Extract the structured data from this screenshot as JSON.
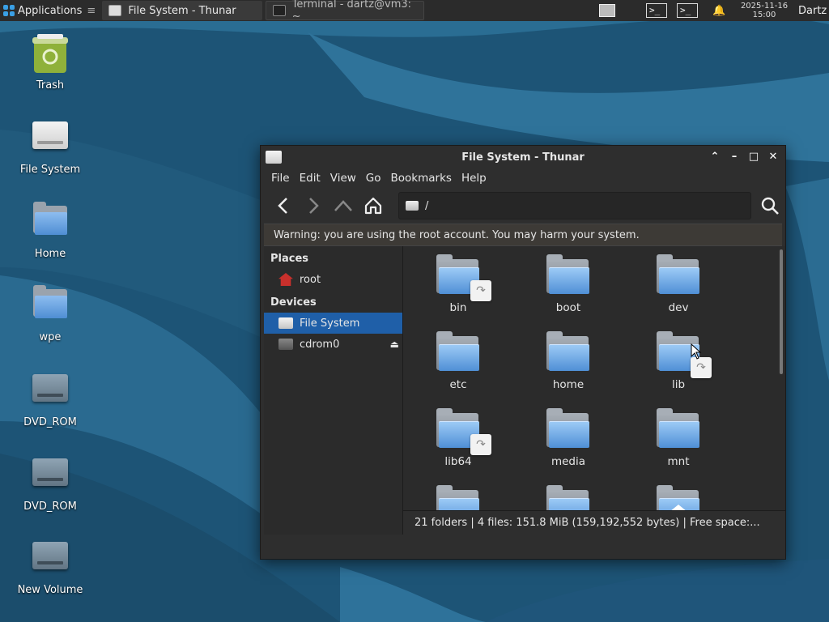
{
  "panel": {
    "applications_label": "Applications",
    "tasks": [
      {
        "label": "File System - Thunar",
        "active": true
      },
      {
        "label": "Terminal - dartz@vm3: ~",
        "active": false
      }
    ],
    "clock_date": "2025-11-16",
    "clock_time": "15:00",
    "user": "Dartz"
  },
  "desktop": {
    "icons": [
      {
        "label": "Trash",
        "icon": "trash-icon"
      },
      {
        "label": "File System",
        "icon": "drive-icon"
      },
      {
        "label": "Home",
        "icon": "home-folder-icon"
      },
      {
        "label": "wpe",
        "icon": "folder-icon"
      },
      {
        "label": "DVD_ROM",
        "icon": "dvd-drive-icon"
      },
      {
        "label": "DVD_ROM",
        "icon": "dvd-drive-icon"
      },
      {
        "label": "New Volume",
        "icon": "drive-icon"
      }
    ]
  },
  "window": {
    "title": "File System - Thunar",
    "menu": [
      "File",
      "Edit",
      "View",
      "Go",
      "Bookmarks",
      "Help"
    ],
    "path": "/",
    "warning": "Warning: you are using the root account. You may harm your system.",
    "sidebar": {
      "places_header": "Places",
      "places": [
        {
          "label": "root",
          "icon": "home-icon"
        }
      ],
      "devices_header": "Devices",
      "devices": [
        {
          "label": "File System",
          "icon": "drive-icon",
          "selected": true
        },
        {
          "label": "cdrom0",
          "icon": "cdrom-icon",
          "selected": false
        }
      ]
    },
    "files": [
      {
        "name": "bin",
        "symlink": true
      },
      {
        "name": "boot",
        "symlink": false
      },
      {
        "name": "dev",
        "symlink": false
      },
      {
        "name": "etc",
        "symlink": false
      },
      {
        "name": "home",
        "symlink": false
      },
      {
        "name": "lib",
        "symlink": true
      },
      {
        "name": "lib64",
        "symlink": true
      },
      {
        "name": "media",
        "symlink": false
      },
      {
        "name": "mnt",
        "symlink": false
      },
      {
        "name": "",
        "symlink": false
      },
      {
        "name": "",
        "symlink": false
      },
      {
        "name": "",
        "symlink": false,
        "home": true
      }
    ],
    "status": "21 folders  |  4 files: 151.8 MiB (159,192,552 bytes)  |  Free space:..."
  }
}
